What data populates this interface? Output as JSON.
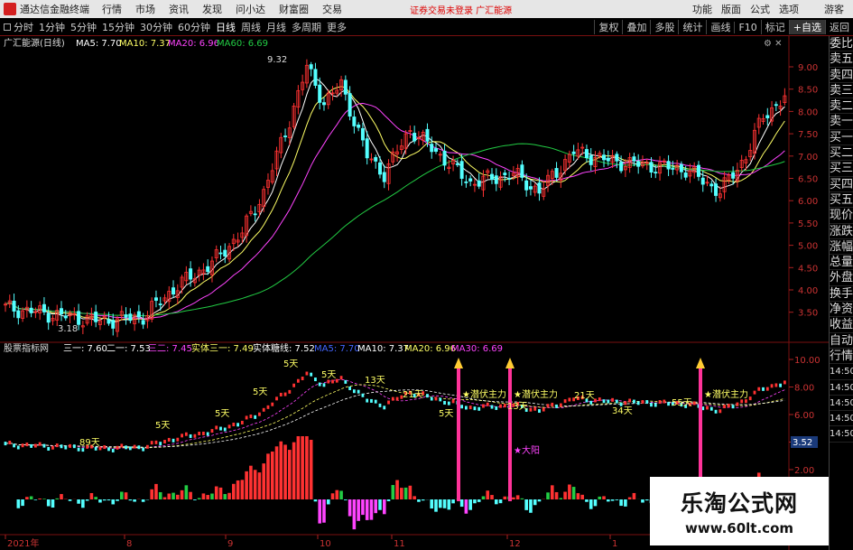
{
  "title_bar": {
    "app_name": "通达信金融终端",
    "menu": [
      "行情",
      "市场",
      "资讯",
      "发现",
      "问小达",
      "财富圈",
      "交易"
    ],
    "notice": "证券交易未登录  广汇能源",
    "right_menu": [
      "功能",
      "版面",
      "公式",
      "选项"
    ],
    "user": "游客"
  },
  "toolbar": {
    "periods": [
      "分时",
      "1分钟",
      "5分钟",
      "15分钟",
      "30分钟",
      "60分钟",
      "日线",
      "周线",
      "月线",
      "多周期",
      "更多"
    ],
    "active_period": "日线",
    "right_buttons": [
      "复权",
      "叠加",
      "多股",
      "统计",
      "画线",
      "F10",
      "标记",
      "+自选",
      "返回"
    ]
  },
  "main_chart": {
    "legend": {
      "stock": "广汇能源(日线)",
      "ma5": "MA5: 7.70",
      "ma10": "MA10: 7.37",
      "ma20": "MA20: 6.96",
      "ma60": "MA60: 6.69"
    },
    "annotations": {
      "high": "9.32",
      "low": "3.18"
    },
    "y_ticks": [
      "9.00",
      "8.50",
      "8.00",
      "7.50",
      "7.00",
      "6.50",
      "6.00",
      "5.50",
      "5.00",
      "4.50",
      "4.00",
      "3.50"
    ]
  },
  "indicator_panel": {
    "legend": {
      "name": "股票指标网",
      "san_yi": "三一: 7.60",
      "er_yi": "二一: 7.53",
      "san_er": "三二: 7.45",
      "shiti_san_yi": "实体三一: 7.49",
      "shiti_lianxian": "实体糖线: 7.52",
      "ma5": "MA5: 7.70",
      "ma10": "MA10: 7.37",
      "ma20": "MA20: 6.96",
      "ma30": "MA30: 6.69"
    },
    "y_ticks": [
      "10.00",
      "8.00",
      "6.00",
      "4.00",
      "2.00"
    ],
    "current_tag": "3.52",
    "day_labels": [
      "89天",
      "5天",
      "5天",
      "5天",
      "5天",
      "5天",
      "13天",
      "21天",
      "5天",
      "13天",
      "21天",
      "34天",
      "55天"
    ],
    "signal_labels": [
      "潜伏主力",
      "潜伏主力",
      "潜伏主力"
    ],
    "big_yang": "大阳"
  },
  "x_axis": [
    "2021年",
    "8",
    "9",
    "10",
    "11",
    "12",
    "1"
  ],
  "side_panel": [
    "委比",
    "卖五",
    "卖四",
    "卖三",
    "卖二",
    "卖一",
    "买一",
    "买二",
    "买三",
    "买四",
    "买五",
    "现价",
    "涨跌",
    "涨幅",
    "总量",
    "外盘",
    "换手",
    "净资",
    "收益",
    "自动",
    "行情",
    "14:50",
    "14:50",
    "14:50",
    "14:50",
    "14:50"
  ],
  "watermark": {
    "line1": "乐淘公式网",
    "line2": "www.60lt.com"
  },
  "colors": {
    "up": "#ff3232",
    "down": "#54ffff",
    "ma5": "#ffffff",
    "ma10": "#ffff66",
    "ma20": "#ff44ff",
    "ma60": "#22cc44",
    "signal": "#ff3399"
  }
}
